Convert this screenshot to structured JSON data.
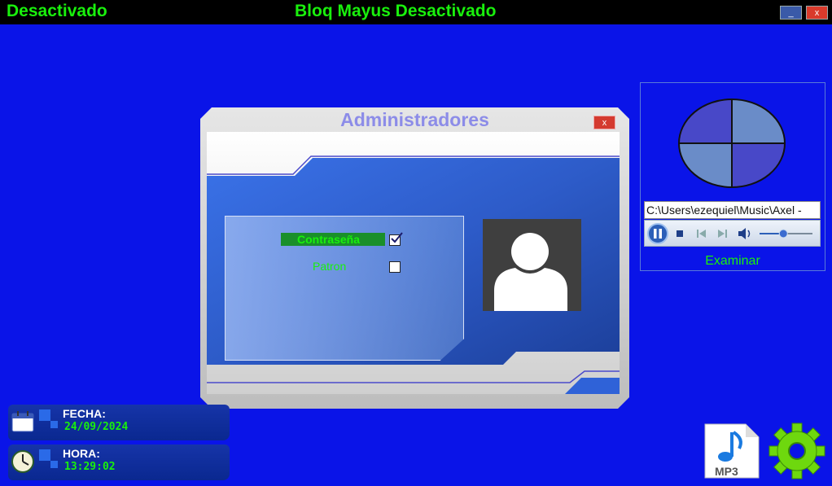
{
  "topbar": {
    "status_left": "Desactivado",
    "caps_status": "Bloq Mayus Desactivado",
    "minimize_label": "_",
    "close_label": "x"
  },
  "dialog": {
    "title": "Administradores",
    "close_label": "x",
    "options": [
      {
        "label": "Contraseña",
        "checked": true,
        "selected": true
      },
      {
        "label": "Patron",
        "checked": false,
        "selected": false
      }
    ]
  },
  "media": {
    "path": "C:\\Users\\ezequiel\\Music\\Axel - ",
    "examine_label": "Examinar",
    "volume_level": 0.45
  },
  "datetime": {
    "date_label": "FECHA:",
    "date_value": "24/09/2024",
    "time_label": "HORA:",
    "time_value": "13:29:02"
  },
  "icons": {
    "mp3_label": "MP3"
  },
  "colors": {
    "background": "#0a14e8",
    "accent_green": "#19f00c",
    "title_purple": "#8c8ce8"
  }
}
